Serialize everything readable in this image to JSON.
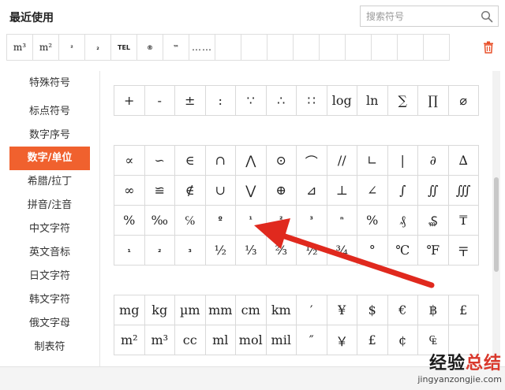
{
  "recent": {
    "title": "最近使用",
    "items": [
      "m³",
      "m²",
      "²",
      "₂",
      "TEL",
      "®",
      "™",
      "……",
      "",
      "",
      "",
      "",
      "",
      "",
      "",
      "",
      ""
    ]
  },
  "search": {
    "placeholder": "搜索符号"
  },
  "sidebar": {
    "items": [
      "特殊符号",
      "标点符号",
      "数字序号",
      "数字/单位",
      "希腊/拉丁",
      "拼音/注音",
      "中文字符",
      "英文音标",
      "日文字符",
      "韩文字符",
      "俄文字母",
      "制表符"
    ],
    "active_index": 3
  },
  "groups": [
    {
      "rows": [
        [
          "+",
          "-",
          "±",
          ":",
          "∵",
          "∴",
          "∷",
          "log",
          "ln",
          "∑",
          "∏",
          "⌀"
        ]
      ]
    },
    {
      "rows": [
        [
          "∝",
          "∽",
          "∈",
          "∩",
          "⋀",
          "⊙",
          "⌒",
          "//",
          "∟",
          "|",
          "∂",
          "∆"
        ],
        [
          "∞",
          "≌",
          "∉",
          "∪",
          "⋁",
          "⊕",
          "⊿",
          "⊥",
          "∠",
          "∫",
          "∬",
          "∭"
        ],
        [
          "%",
          "‰",
          "℅",
          "º",
          "¹",
          "²",
          "³",
          "ⁿ",
          "%",
          "₰",
          "₷",
          "₸"
        ],
        [
          "₁",
          "₂",
          "₃",
          "½",
          "⅓",
          "⅔",
          "½",
          "¾",
          "°",
          "℃",
          "℉",
          "〒"
        ]
      ]
    },
    {
      "rows": [
        [
          "mg",
          "kg",
          "µm",
          "mm",
          "cm",
          "km",
          "′",
          "¥",
          "$",
          "€",
          "฿",
          "£"
        ],
        [
          "m²",
          "m³",
          "cc",
          "ml",
          "mol",
          "mil",
          "″",
          "￥",
          "£",
          "¢",
          "₠",
          ""
        ]
      ]
    }
  ],
  "watermark": {
    "brand_prefix": "经验",
    "brand_highlight": "总结",
    "url": "jingyanzongjie.com"
  },
  "colors": {
    "accent": "#f0612e",
    "arrow": "#e0291e",
    "trash": "#e8502a"
  }
}
